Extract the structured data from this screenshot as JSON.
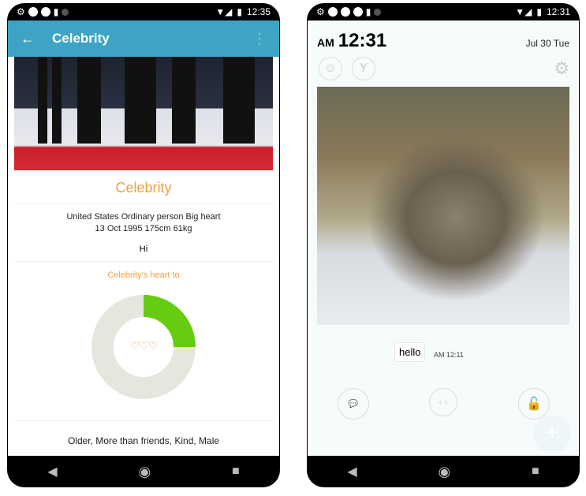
{
  "left": {
    "status_time": "12:35",
    "appbar": {
      "title": "Celebrity"
    },
    "name": "Celebrity",
    "info_line1": "United States Ordinary person Big heart",
    "info_line2": "13 Oct 1995  175cm 61kg",
    "greeting": "Hi",
    "heart_label": "Celebrity's heart to",
    "heart_fraction": 0.25,
    "hearts": "♡♡♡",
    "tags": "Older, More than friends, Kind, Male",
    "colors": {
      "appbar": "#3fa4c4",
      "accent": "#f0a040",
      "donut_fill": "#66cc11",
      "donut_track": "#e6e6de"
    }
  },
  "right": {
    "status_time": "12:31",
    "clock_ampm": "AM",
    "clock_time": "12:31",
    "date": "Jul 30 Tue",
    "message": "hello",
    "message_time": "AM 12:11"
  }
}
